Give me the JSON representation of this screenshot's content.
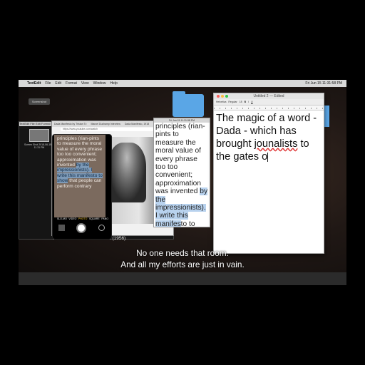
{
  "menubar": {
    "apple": "",
    "app_name": "TextEdit",
    "items": [
      "File",
      "Edit",
      "Format",
      "View",
      "Window",
      "Help"
    ],
    "status": "Fri Jun 15  11:31:58 PM"
  },
  "desktop": {
    "screenshot_label": "Screenshot",
    "thumb_caption": "Screen Shot 2018-06-15 at 11.31 PM"
  },
  "dark_window": {
    "title": "TextEdit  File  Edit  Format  View  Window  Help"
  },
  "browser": {
    "tabs": [
      "Dada Manifesto by Tristan Tz",
      "Marcel Duchamp Interview",
      "Dada Manifesto, 1918"
    ],
    "url": "https://www.youtube.com/watch",
    "caption": "to interview on Art and Dada (1956)"
  },
  "phone": {
    "text_before": "principles (rian-pints to measure the moral value of every phrase too too convenient; approximation was invented ",
    "text_hl": "by the impressionists). I write this manifesto to show",
    "text_after": " that people can perform contrary",
    "modes": [
      "SLO-MO",
      "VIDEO",
      "PHOTO",
      "SQUARE",
      "PANO"
    ]
  },
  "doc": {
    "title": "Fri Jun 15 11:31:58 PM",
    "text_before": "principles (rian-pints to measure the moral value of every phrase too too convenient; approximation was invented ",
    "text_hl": "by the impressionists). I write this manifes",
    "text_after": "to to show that people can perform contrary actions together"
  },
  "textedit": {
    "title": "Untitled 2 — Edited",
    "toolbar": [
      "Helvetica",
      "Regular",
      "18",
      "B",
      "I",
      "U"
    ],
    "text_part1": "The magic of a word - Dada - which has brought ",
    "text_misspelled": "jounalists",
    "text_part2": " to the gates o"
  },
  "subtitles": {
    "line1": "No one needs that room.",
    "line2": "And all my efforts are just in vain."
  },
  "colors": {
    "folder": "#5aa6e6",
    "highlight": "#b8d2ee"
  }
}
